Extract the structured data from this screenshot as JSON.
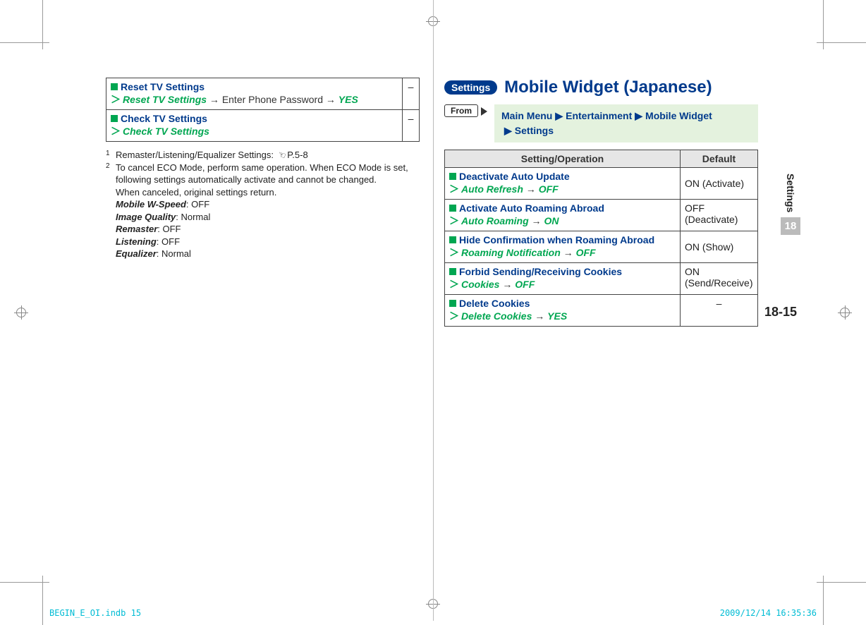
{
  "crop_color": "#999",
  "left_table": {
    "rows": [
      {
        "title": "Reset TV Settings",
        "path_prefix": "Reset TV Settings",
        "path_middle_plain": "Enter Phone Password",
        "path_end": "YES",
        "default": "–"
      },
      {
        "title": "Check TV Settings",
        "path_prefix": "Check TV Settings",
        "default": "–"
      }
    ]
  },
  "footnotes": {
    "f1_text": "Remaster/Listening/Equalizer Settings:",
    "f1_ref": "P.5-8",
    "f2_line1": "To cancel ECO Mode, perform same operation. When ECO Mode is set, following settings automatically activate and cannot be changed.",
    "f2_line2": "When canceled, original settings return.",
    "items": [
      {
        "label": "Mobile W-Speed",
        "value": "OFF"
      },
      {
        "label": "Image Quality",
        "value": "Normal"
      },
      {
        "label": "Remaster",
        "value": "OFF"
      },
      {
        "label": "Listening",
        "value": "OFF"
      },
      {
        "label": "Equalizer",
        "value": "Normal"
      }
    ]
  },
  "section": {
    "pill": "Settings",
    "title": "Mobile Widget (Japanese)"
  },
  "from": {
    "label": "From",
    "parts": [
      "Main Menu",
      "Entertainment",
      "Mobile Widget",
      "Settings"
    ]
  },
  "right_table": {
    "headers": [
      "Setting/Operation",
      "Default"
    ],
    "rows": [
      {
        "title": "Deactivate Auto Update",
        "path_prefix": "Auto Refresh",
        "path_end": "OFF",
        "default": "ON (Activate)"
      },
      {
        "title": "Activate Auto Roaming Abroad",
        "path_prefix": "Auto Roaming",
        "path_end": "ON",
        "default": "OFF (Deactivate)"
      },
      {
        "title": "Hide Confirmation when Roaming Abroad",
        "path_prefix": "Roaming Notification",
        "path_end": "OFF",
        "default": "ON (Show)"
      },
      {
        "title": "Forbid Sending/Receiving Cookies",
        "path_prefix": "Cookies",
        "path_end": "OFF",
        "default": "ON (Send/Receive)"
      },
      {
        "title": "Delete Cookies",
        "path_prefix": "Delete Cookies",
        "path_end": "YES",
        "default": "–"
      }
    ]
  },
  "side": {
    "label": "Settings",
    "num": "18"
  },
  "page_number": "18-15",
  "footer": {
    "left": "BEGIN_E_OI.indb   15",
    "right": "2009/12/14   16:35:36"
  }
}
